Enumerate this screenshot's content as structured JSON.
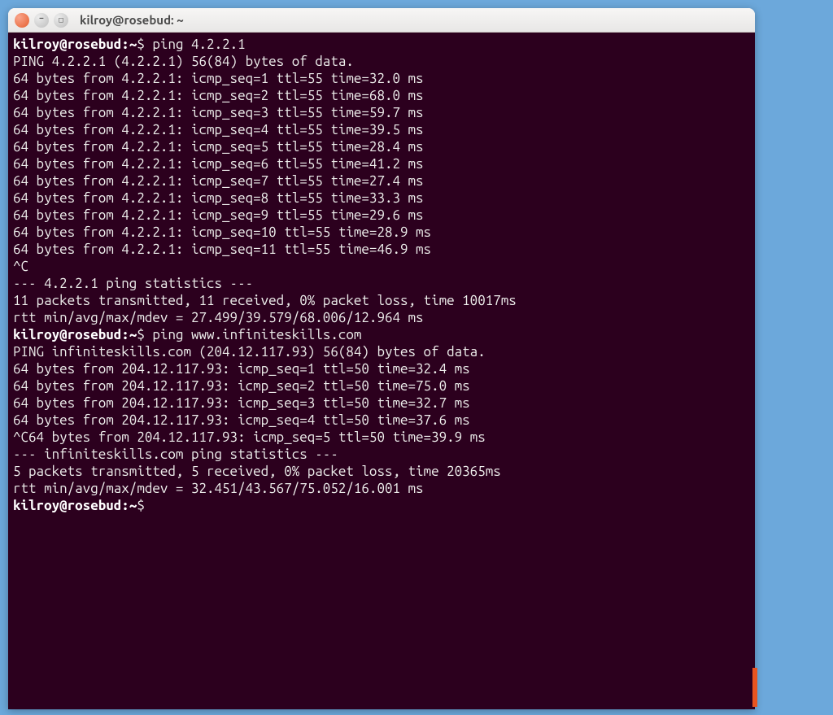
{
  "window": {
    "title": "kilroy@rosebud: ~"
  },
  "prompt": {
    "user_host": "kilroy@rosebud",
    "path": "~",
    "sep": ":",
    "dollar": "$"
  },
  "session": {
    "cmd1": "ping 4.2.2.1",
    "ping1_header": "PING 4.2.2.1 (4.2.2.1) 56(84) bytes of data.",
    "ping1_lines": [
      "64 bytes from 4.2.2.1: icmp_seq=1 ttl=55 time=32.0 ms",
      "64 bytes from 4.2.2.1: icmp_seq=2 ttl=55 time=68.0 ms",
      "64 bytes from 4.2.2.1: icmp_seq=3 ttl=55 time=59.7 ms",
      "64 bytes from 4.2.2.1: icmp_seq=4 ttl=55 time=39.5 ms",
      "64 bytes from 4.2.2.1: icmp_seq=5 ttl=55 time=28.4 ms",
      "64 bytes from 4.2.2.1: icmp_seq=6 ttl=55 time=41.2 ms",
      "64 bytes from 4.2.2.1: icmp_seq=7 ttl=55 time=27.4 ms",
      "64 bytes from 4.2.2.1: icmp_seq=8 ttl=55 time=33.3 ms",
      "64 bytes from 4.2.2.1: icmp_seq=9 ttl=55 time=29.6 ms",
      "64 bytes from 4.2.2.1: icmp_seq=10 ttl=55 time=28.9 ms",
      "64 bytes from 4.2.2.1: icmp_seq=11 ttl=55 time=46.9 ms"
    ],
    "ctrl_c1": "^C",
    "stats1_header": "--- 4.2.2.1 ping statistics ---",
    "stats1_line1": "11 packets transmitted, 11 received, 0% packet loss, time 10017ms",
    "stats1_line2": "rtt min/avg/max/mdev = 27.499/39.579/68.006/12.964 ms",
    "cmd2": "ping www.infiniteskills.com",
    "ping2_header": "PING infiniteskills.com (204.12.117.93) 56(84) bytes of data.",
    "ping2_lines": [
      "64 bytes from 204.12.117.93: icmp_seq=1 ttl=50 time=32.4 ms",
      "64 bytes from 204.12.117.93: icmp_seq=2 ttl=50 time=75.0 ms",
      "64 bytes from 204.12.117.93: icmp_seq=3 ttl=50 time=32.7 ms",
      "64 bytes from 204.12.117.93: icmp_seq=4 ttl=50 time=37.6 ms"
    ],
    "ctrl_c2_line": "^C64 bytes from 204.12.117.93: icmp_seq=5 ttl=50 time=39.9 ms",
    "blank": "",
    "stats2_header": "--- infiniteskills.com ping statistics ---",
    "stats2_line1": "5 packets transmitted, 5 received, 0% packet loss, time 20365ms",
    "stats2_line2": "rtt min/avg/max/mdev = 32.451/43.567/75.052/16.001 ms"
  }
}
